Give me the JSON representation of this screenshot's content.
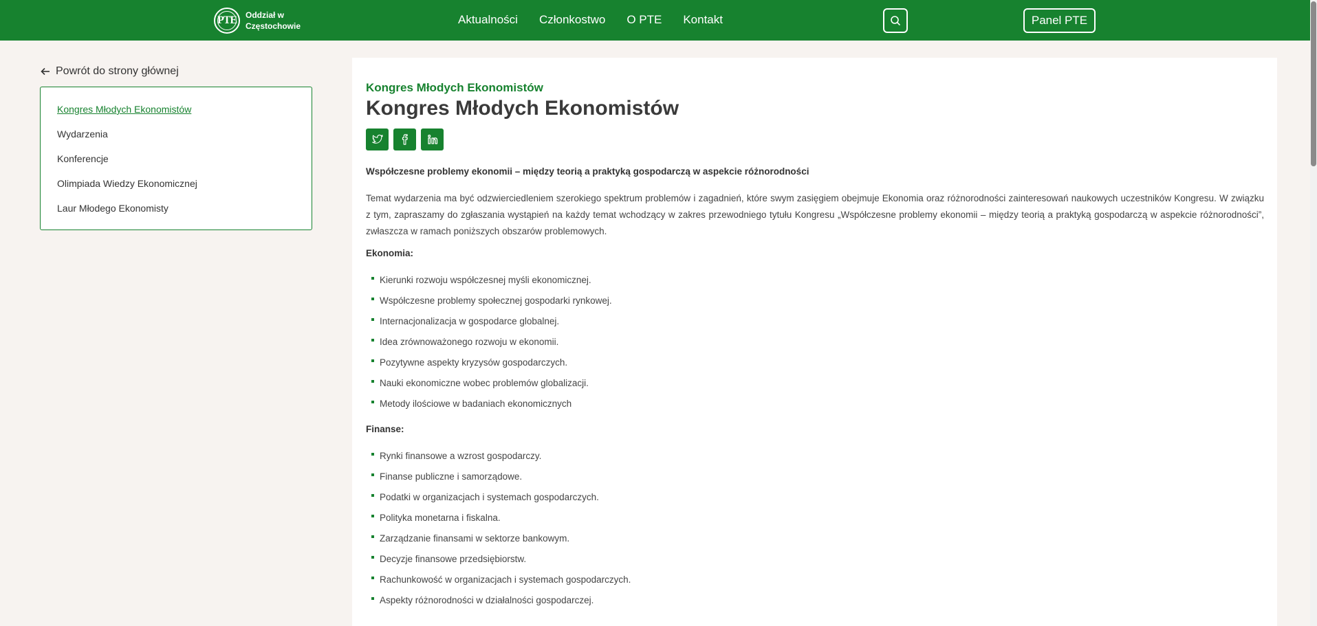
{
  "header": {
    "logo_mark": "PTE",
    "logo_line1": "Oddział w",
    "logo_line2": "Częstochowie",
    "nav": [
      "Aktualności",
      "Członkostwo",
      "O PTE",
      "Kontakt"
    ],
    "panel_label": "Panel PTE",
    "search_icon": "search-icon"
  },
  "sidebar": {
    "back_label": "Powrót do strony głównej",
    "items": [
      {
        "label": "Kongres Młodych Ekonomistów",
        "active": true
      },
      {
        "label": "Wydarzenia"
      },
      {
        "label": "Konferencje"
      },
      {
        "label": "Olimpiada Wiedzy Ekonomicznej"
      },
      {
        "label": "Laur Młodego Ekonomisty"
      }
    ]
  },
  "main": {
    "kicker": "Kongres Młodych Ekonomistów",
    "title": "Kongres Młodych Ekonomistów",
    "share_icons": [
      "twitter-icon",
      "facebook-icon",
      "linkedin-icon"
    ],
    "subtitle": "Współczesne problemy ekonomii – między teorią a praktyką gospodarczą w aspekcie różnorodności",
    "intro": "Temat wydarzenia ma być odzwierciedleniem szerokiego spektrum problemów i zagadnień, które swym zasięgiem obejmuje Ekonomia oraz różnorodności zainteresowań naukowych uczestników Kongresu. W związku z tym, zapraszamy do zgłaszania wystąpień na każdy temat wchodzący w zakres przewodniego tytułu Kongresu „Współczesne problemy ekonomii – między teorią a praktyką gospodarczą w aspekcie różnorodności”, zwłaszcza w ramach poniższych obszarów problemowych.",
    "sections": [
      {
        "heading": "Ekonomia:",
        "items": [
          "Kierunki rozwoju współczesnej myśli ekonomicznej.",
          "Współczesne problemy społecznej gospodarki rynkowej.",
          "Internacjonalizacja w gospodarce globalnej.",
          "Idea zrównoważonego rozwoju w ekonomii.",
          "Pozytywne aspekty kryzysów gospodarczych.",
          "Nauki ekonomiczne wobec problemów globalizacji.",
          "Metody ilościowe w badaniach ekonomicznych"
        ]
      },
      {
        "heading": "Finanse:",
        "items": [
          "Rynki finansowe a wzrost gospodarczy.",
          "Finanse publiczne i samorządowe.",
          "Podatki w organizacjach i systemach gospodarczych.",
          "Polityka monetarna i fiskalna.",
          "Zarządzanie finansami w sektorze bankowym.",
          "Decyzje finansowe przedsiębiorstw.",
          "Rachunkowość w organizacjach i systemach gospodarczych.",
          "Aspekty różnorodności w działalności gospodarczej."
        ]
      }
    ]
  },
  "colors": {
    "brand_green": "#17822f",
    "background": "#f7f3f0"
  }
}
